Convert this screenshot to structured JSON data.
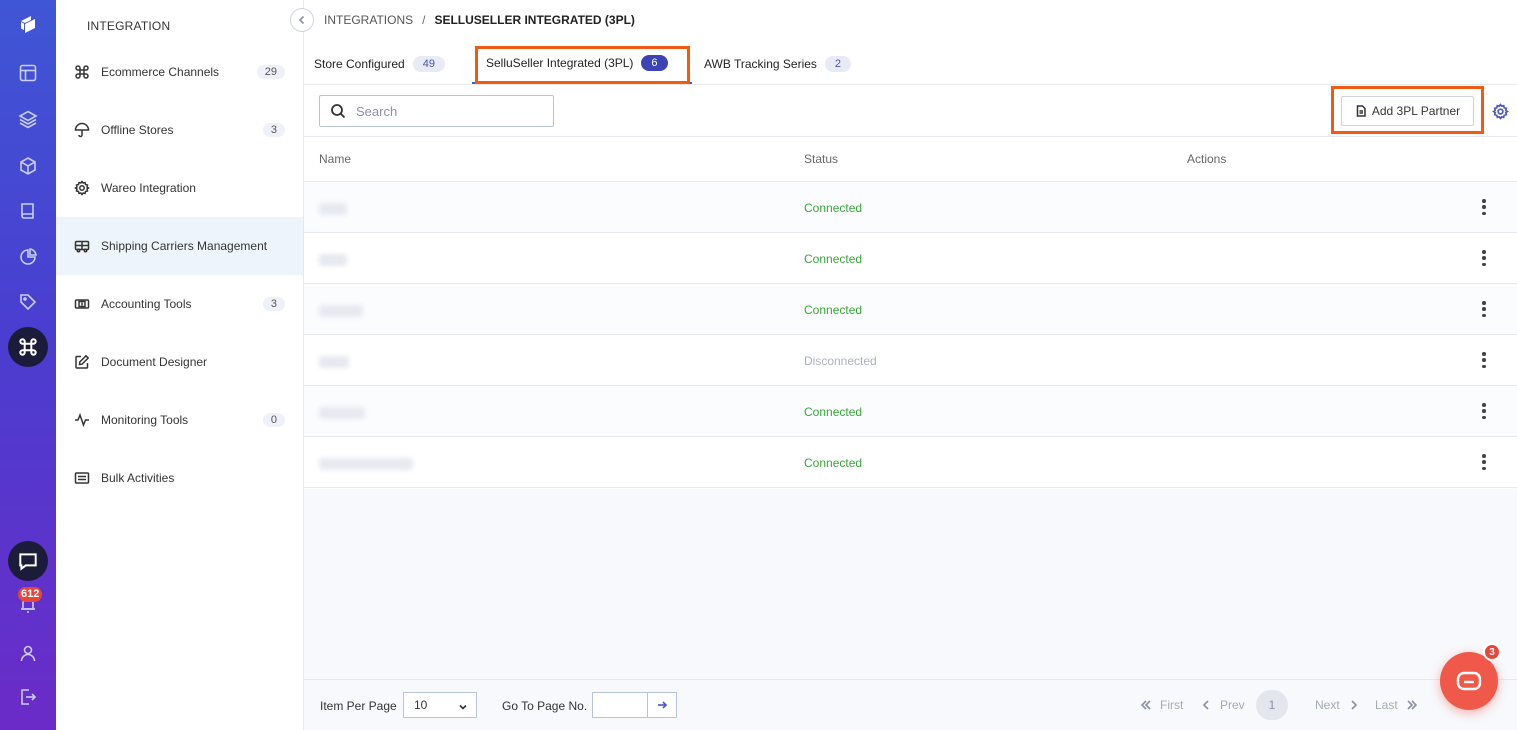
{
  "sidebar": {
    "title": "INTEGRATION",
    "items": [
      {
        "label": "Ecommerce Channels",
        "count": "29",
        "icon": "command-icon"
      },
      {
        "label": "Offline Stores",
        "count": "3",
        "icon": "umbrella-icon"
      },
      {
        "label": "Wareo Integration",
        "count": "",
        "icon": "gear-icon"
      },
      {
        "label": "Shipping Carriers Management",
        "count": "",
        "icon": "truck-icon"
      },
      {
        "label": "Accounting Tools",
        "count": "3",
        "icon": "cash-icon"
      },
      {
        "label": "Document Designer",
        "count": "",
        "icon": "edit-icon"
      },
      {
        "label": "Monitoring Tools",
        "count": "0",
        "icon": "activity-icon"
      },
      {
        "label": "Bulk Activities",
        "count": "",
        "icon": "list-icon"
      }
    ]
  },
  "rail": {
    "notification_count": "612"
  },
  "breadcrumb": {
    "root": "INTEGRATIONS",
    "separator": "/",
    "current": "SELLUSELLER INTEGRATED (3PL)"
  },
  "tabs": [
    {
      "label": "Store Configured",
      "count": "49"
    },
    {
      "label": "SelluSeller Integrated (3PL)",
      "count": "6"
    },
    {
      "label": "AWB Tracking Series",
      "count": "2"
    }
  ],
  "toolbar": {
    "search_placeholder": "Search",
    "add_button": "Add 3PL Partner"
  },
  "table": {
    "headers": {
      "name": "Name",
      "status": "Status",
      "actions": "Actions"
    },
    "rows": [
      {
        "status": "Connected"
      },
      {
        "status": "Connected"
      },
      {
        "status": "Connected"
      },
      {
        "status": "Disconnected"
      },
      {
        "status": "Connected"
      },
      {
        "status": "Connected"
      }
    ]
  },
  "footer": {
    "items_per_page_label": "Item Per Page",
    "items_per_page_value": "10",
    "go_to_page_label": "Go To Page No.",
    "first": "First",
    "prev": "Prev",
    "current_page": "1",
    "next": "Next",
    "last": "Last"
  },
  "chat_widget": {
    "unread_count": "3"
  },
  "colors": {
    "accent": "#3c44b5",
    "highlight_outline": "#f05a14",
    "connected": "#3aa43a",
    "disconnected": "#aab0bd",
    "chat_fab": "#f0584a"
  }
}
